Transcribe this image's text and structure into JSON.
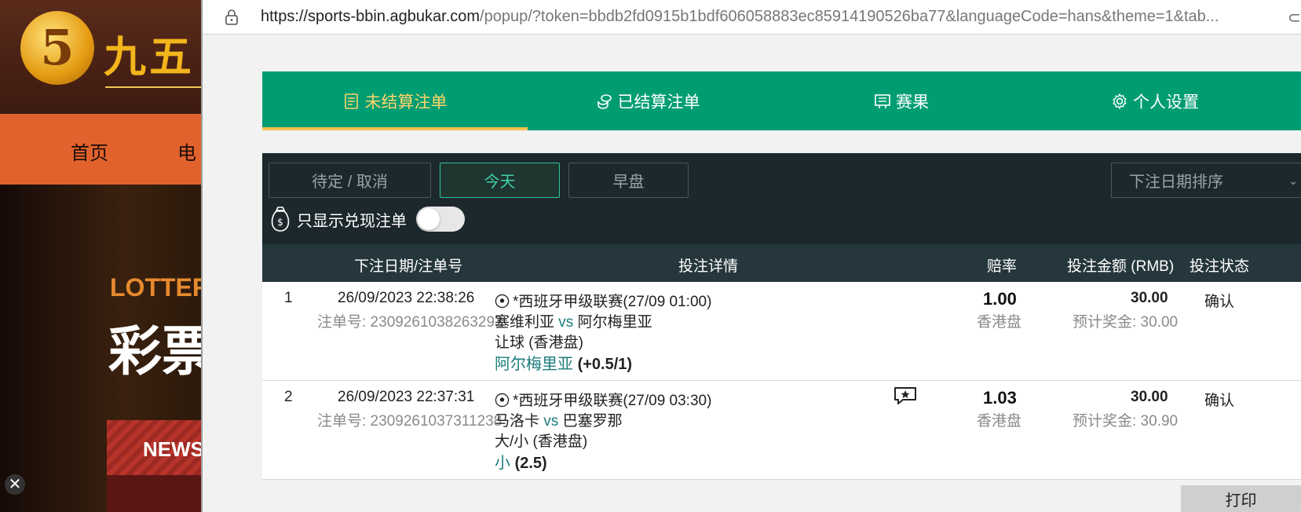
{
  "background_site": {
    "logo_glyph": "5",
    "brand": "九五",
    "nav_items": [
      "首页",
      "电"
    ],
    "banner_title_en": "LOTTER",
    "banner_title_zh": "彩票",
    "news_label": "NEWS",
    "close_glyph": "✕"
  },
  "address_bar": {
    "url_host": "https://sports-bbin.agbukar.com",
    "url_rest": "/popup/?token=bbdb2fd0915b1bdf606058883ec85914190526ba77&languageCode=hans&theme=1&tab...",
    "edge_glyph": "⊂"
  },
  "tabs": [
    {
      "label": "未结算注单",
      "icon": "list-icon",
      "active": true
    },
    {
      "label": "已结算注单",
      "icon": "coins-icon",
      "active": false
    },
    {
      "label": "赛果",
      "icon": "board-icon",
      "active": false
    },
    {
      "label": "个人设置",
      "icon": "gear-icon",
      "active": false
    }
  ],
  "filters": {
    "pending_cancel": "待定 / 取消",
    "today": "今天",
    "early": "早盘",
    "sort_label": "下注日期排序",
    "cashout_only": "只显示兑现注单"
  },
  "table": {
    "headers": {
      "date_no": "下注日期/注单号",
      "details": "投注详情",
      "odds": "赔率",
      "amount": "投注金额 (RMB)",
      "status": "投注状态"
    },
    "rows": [
      {
        "index": "1",
        "datetime": "26/09/2023 22:38:26",
        "bet_no": "注单号: 2309261038263293",
        "league": "*西班牙甲级联赛(27/09 01:00)",
        "home": "塞维利亚",
        "vs": "vs",
        "away": "阿尔梅里亚",
        "market": "让球 (香港盘)",
        "selection": "阿尔梅里亚",
        "selection_value": "(+0.5/1)",
        "odds": "1.00",
        "odds_type": "香港盘",
        "stake": "30.00",
        "payout": "预计奖金: 30.00",
        "status": "确认",
        "has_chat_icon": false
      },
      {
        "index": "2",
        "datetime": "26/09/2023 22:37:31",
        "bet_no": "注单号: 2309261037311238",
        "league": "*西班牙甲级联赛(27/09 03:30)",
        "home": "马洛卡",
        "vs": "vs",
        "away": "巴塞罗那",
        "market": "大/小 (香港盘)",
        "selection": "小",
        "selection_value": "(2.5)",
        "odds": "1.03",
        "odds_type": "香港盘",
        "stake": "30.00",
        "payout": "预计奖金: 30.90",
        "status": "确认",
        "has_chat_icon": true
      }
    ]
  },
  "print_label": "打印",
  "colors": {
    "tab_bg": "#009d72",
    "tab_active_text": "#ffd56b",
    "filter_bg": "#1c282c",
    "header_bg": "#25373c",
    "teal_text": "#1d7c7c"
  }
}
